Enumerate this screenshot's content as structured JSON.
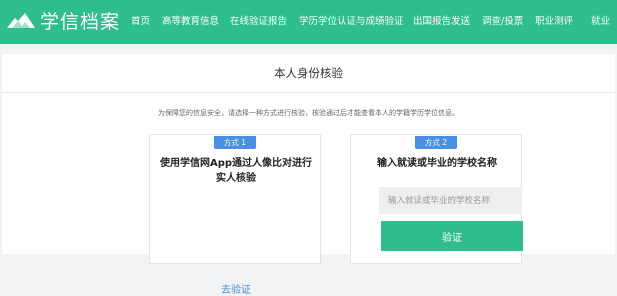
{
  "header": {
    "brand": "学信档案",
    "nav": [
      "首页",
      "高等教育信息",
      "在线验证报告",
      "学历学位认证与成绩验证",
      "出国报告发送",
      "调查/投票",
      "职业测评",
      "就业"
    ]
  },
  "main": {
    "title": "本人身份核验",
    "notice": "为保障您的信息安全，请选择一种方式进行核验，核验通过后才能查看本人的学籍学历学位信息。",
    "method1": {
      "badge": "方式 1",
      "title": "使用学信网App通过人像比对进行实人核验",
      "link": "去验证"
    },
    "method2": {
      "badge": "方式 2",
      "title": "输入就读或毕业的学校名称",
      "input_placeholder": "输入就读或毕业的学校名称",
      "input_value": "",
      "button": "验证"
    }
  },
  "colors": {
    "primary": "#2ebd8d",
    "badge": "#4a90e2",
    "link": "#3e8ed9"
  }
}
